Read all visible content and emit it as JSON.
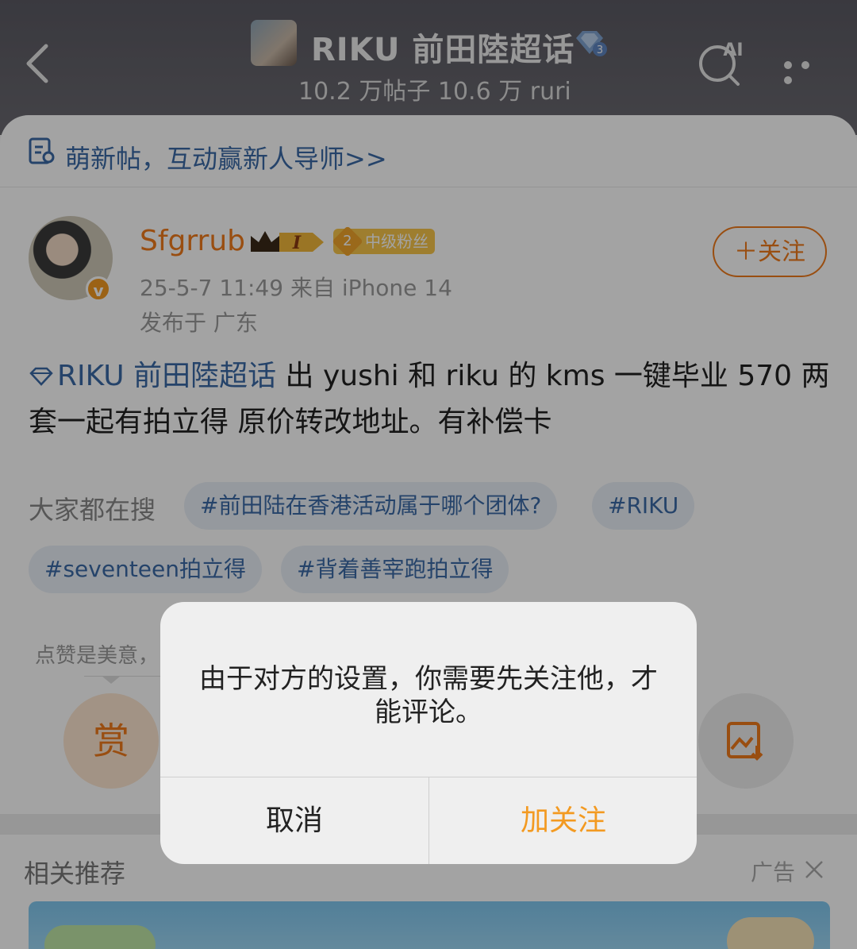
{
  "header": {
    "topic_title": "RIKU 前田陸超话",
    "topic_stats": "10.2 万帖子 10.6 万 ruri",
    "ai_label": "AI"
  },
  "notice": {
    "text": "萌新帖，互动赢新人导师>>"
  },
  "post": {
    "username": "Sfgrrub",
    "level_badge": "I",
    "fan_level": "2",
    "fan_badge_label": "中级粉丝",
    "verified_mark": "v",
    "time_source": "25-5-7 11:49  来自 iPhone 14",
    "location": "发布于 广东",
    "follow_label": "＋关注",
    "topic_link": "RIKU 前田陸超话",
    "body": "  出 yushi 和 riku 的 kms 一键毕业 570 两套一起有拍立得 原价转改地址。有补偿卡"
  },
  "search": {
    "label": "大家都在搜",
    "chips": [
      "#前田陆在香港活动属于哪个团体?",
      "#RIKU",
      "#seventeen拍立得",
      "#背着善宰跑拍立得"
    ]
  },
  "like_note": "点赞是美意，",
  "reward_label": "赏",
  "related": {
    "label": "相关推荐",
    "ad_label": "广告"
  },
  "dialog": {
    "message": "由于对方的设置，你需要先关注他，才能评论。",
    "cancel": "取消",
    "confirm": "加关注"
  },
  "colors": {
    "accent_orange": "#f07a1b",
    "link_blue": "#3a6aa6",
    "dialog_confirm": "#f39a21"
  }
}
